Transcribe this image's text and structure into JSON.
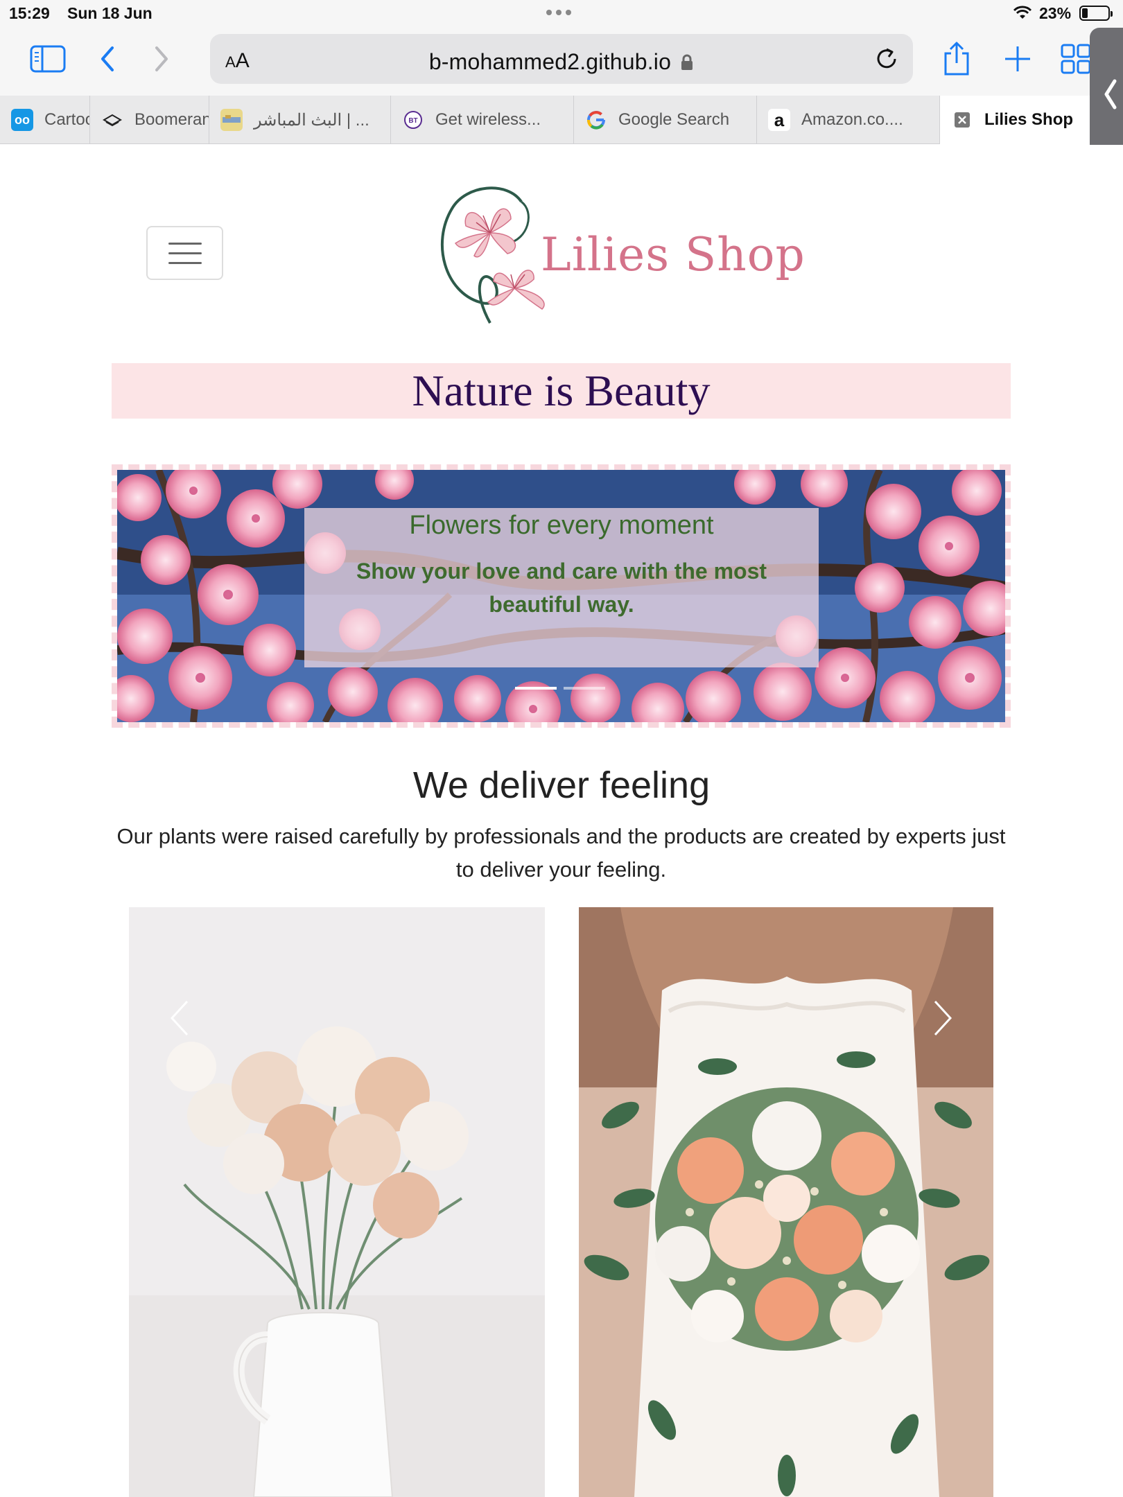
{
  "status": {
    "time": "15:29",
    "date": "Sun 18 Jun",
    "battery": "23%"
  },
  "toolbar": {
    "reader_label": "AA",
    "url": "b-mohammed2.github.io"
  },
  "tabs": [
    {
      "label": "Cartoon Network",
      "icon": "cartoon-network-icon"
    },
    {
      "label": "Boomerang",
      "icon": "boomerang-icon"
    },
    {
      "label": "البث المباشر | ...",
      "icon": "live-stream-icon"
    },
    {
      "label": "Get wireless...",
      "icon": "bt-icon"
    },
    {
      "label": "Google Search",
      "icon": "google-icon"
    },
    {
      "label": "Amazon.co....",
      "icon": "amazon-icon"
    },
    {
      "label": "Lilies Shop",
      "icon": "close-tab-icon"
    }
  ],
  "site": {
    "brand": "Lilies Shop",
    "tagline": "Nature is Beauty",
    "carousel": {
      "title": "Flowers for every moment",
      "subtitle": "Show your love and care with the most beautiful way.",
      "slides": 2,
      "active_slide": 1
    },
    "section": {
      "title": "We deliver feeling",
      "text": "Our plants were raised carefully by professionals and the products are created by experts just to deliver your feeling."
    }
  },
  "colors": {
    "banner_bg": "#fce4e6",
    "banner_text": "#2d0e52",
    "brand_pink": "#d4738a",
    "caption_green": "#3e6b2e",
    "accent_blue": "#1a7cf3"
  }
}
